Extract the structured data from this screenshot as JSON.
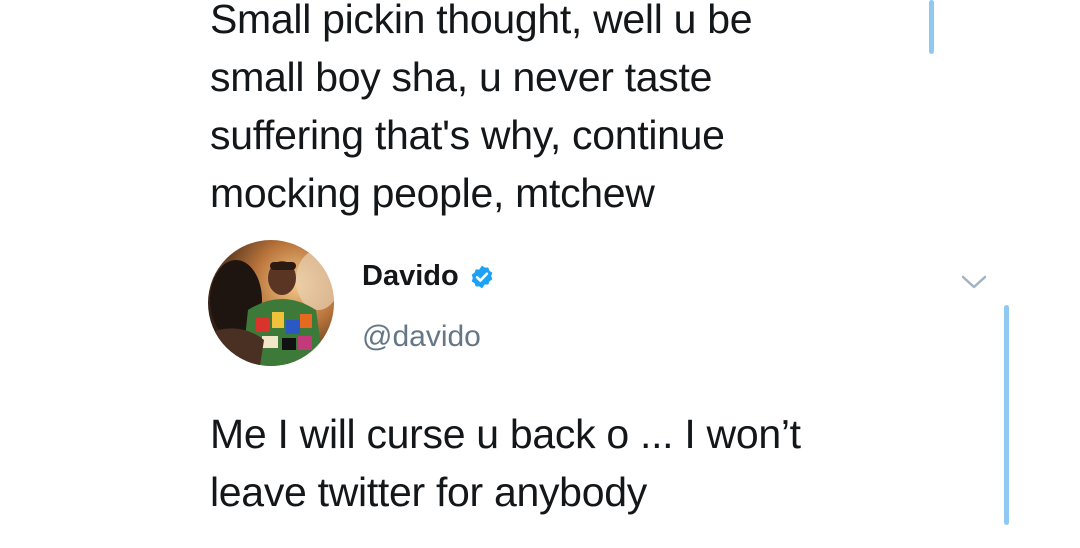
{
  "previous_tweet": {
    "text_lines": [
      "Small pickin thought, well u be",
      "small boy sha, u never taste",
      "suffering that's why, continue",
      "mocking people, mtchew"
    ]
  },
  "reply": {
    "display_name": "Davido",
    "handle": "@davido",
    "verified": true,
    "avatar_icon": "user-photo-avatar",
    "verified_icon": "verified-badge-icon",
    "menu_icon": "chevron-down-icon",
    "text_lines": [
      "Me I will curse u back o ... I won’t",
      "leave twitter for anybody"
    ]
  },
  "colors": {
    "text": "#14171a",
    "handle": "#657786",
    "verified_blue": "#1da1f2",
    "thread_line": "#8fc9f2"
  }
}
